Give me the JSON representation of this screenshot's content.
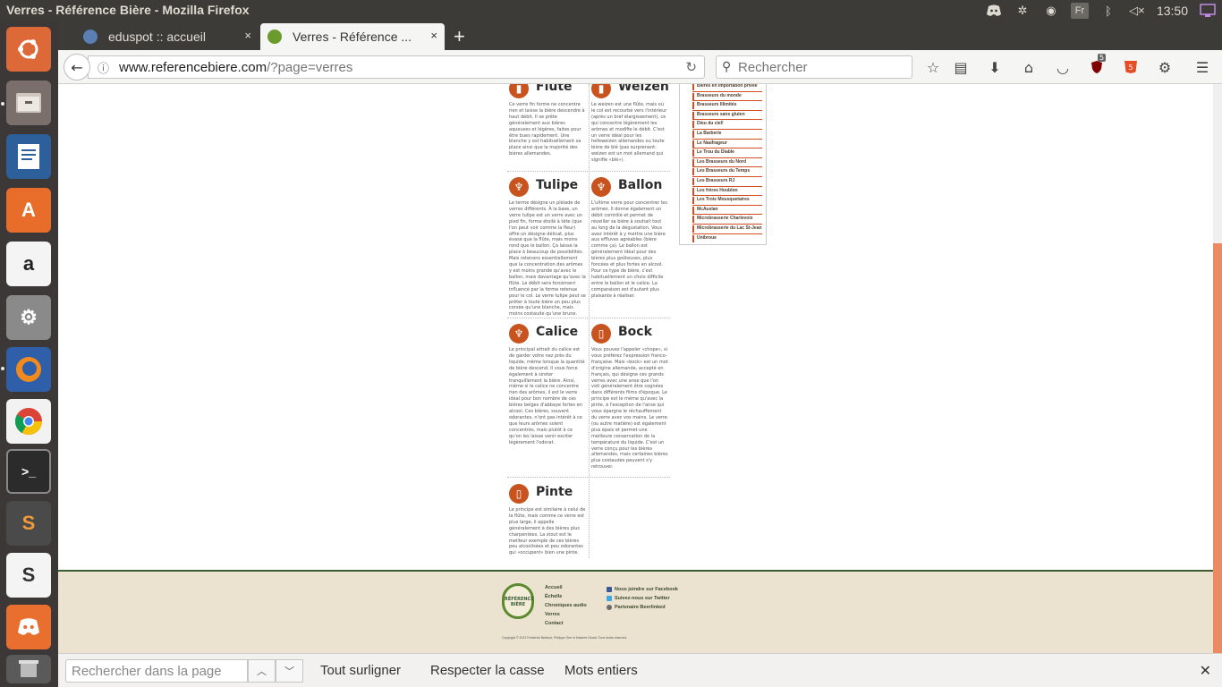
{
  "window": {
    "title": "Verres - Référence Bière - Mozilla Firefox",
    "keyboard_layout": "Fr",
    "clock": "13:50"
  },
  "tabs": [
    {
      "label": "eduspot :: accueil",
      "close": "×"
    },
    {
      "label": "Verres - Référence ...",
      "close": "×"
    }
  ],
  "newtab_label": "+",
  "urlbar": {
    "domain": "www.referencebiere.com",
    "path": "/?page=verres"
  },
  "searchbar": {
    "placeholder": "Rechercher"
  },
  "toolbar": {
    "ublock_badge": "5"
  },
  "glasses": [
    {
      "name": "Flûte",
      "icon": "flute-glass-icon",
      "text": "Ce verre fin forme ne concentre rien et laisse la bière descendre à haut débit. Il se prête généralement aux bières aqueuses et légères, faites pour être bues rapidement. Une blanche y est habituellement sa place ainsi que la majorité des bières allemandes."
    },
    {
      "name": "Weizen",
      "icon": "weizen-glass-icon",
      "text": "Le weizen est une flûte, mais où le col est recourbé vers l'intérieur (après un bref élargissement), ce qui concentre légèrement les arômes et modifie le débit. C'est un verre idéal pour les hefeweizen allemandes ou toute bière de blé (pas surprenant: weizen est un mot allemand qui signifie «blé»)."
    },
    {
      "name": "Tulipe",
      "icon": "tulip-glass-icon",
      "text": "Le terme désigne un pléiade de verres différents. À la base, un verre tulipe est un verre avec un pied fin, forme étoilé à tête (que l'on peut voir comme la fleur) offre un désigne délicat, plus évasé que la flûte, mais moins rond que le ballon. Ça laisse la place à beaucoup de possibilités. Mais retenons essentiellement que la concentration des arômes y est moins grande qu'avec le ballon, mais davantage qu'avec la flûte. Le débit sera forcément influencé par la forme retenue pour le col. Le verre tulipe peut se prêter à toute bière un peu plus corsée qu'une blanche, mais moins costaude qu'une brune."
    },
    {
      "name": "Ballon",
      "icon": "ballon-glass-icon",
      "text": "L'ultime verre pour concentrer les arômes. Il donne également un débit contrôlé et permet de réveiller sa bière à souhait tout au long de la dégustation. Vous avez intérêt à y mettre une bière aux effluves agréables (bière comme ça). Le ballon est généralement idéal pour des bières plus goûteuses, plus foncées et plus fortes en alcool. Pour ce type de bière, c'est habituellement un choix difficile entre le ballon et le calice. La comparaison est d'autant plus plaisante à réaliser."
    },
    {
      "name": "Calice",
      "icon": "calice-glass-icon",
      "text": "Le principal attrait du calice est de garder votre nez près du liquide, même lorsque la quantité de bière descend. Il vous force également à siroter tranquillement la bière. Ainsi, même si le calice ne concentre rien des arômes, il est le verre idéal pour bon nombre de ces bières belges d'abbaye fortes en alcool. Ces bières, souvent odorantes, n'ont pas intérêt à ce que leurs arômes soient concentrés, mais plutôt à ce qu'on les laisse venir exciter légèrement l'odorat."
    },
    {
      "name": "Bock",
      "icon": "bock-mug-icon",
      "text": "Vous pouvez l'appeler «chope», si vous préférez l'expression franco-française. Mais «bock» est un mot d'origine allemande, accepté en français, qui désigne ces grands verres avec une anse que l'on voit généralement être cognées dans différents films d'époque. Le principe est le même qu'avec la pinte, à l'exception de l'anse qui vous épargne le réchauffement du verre avec vos mains. Le verre (ou autre matière) est également plus épais et permet une meilleure conservation de la température du liquide. C'est un verre conçu pour les bières allemandes, mais certaines bières plus costaudes peuvent s'y retrouver."
    },
    {
      "name": "Pinte",
      "icon": "pint-glass-icon",
      "text": "Le principe est similaire à celui de la flûte, mais comme ce verre est plus large, il appelle généralement à des bières plus charpentées. La stout est le meilleur exemple de ces bières peu alcoolisées et peu odorantes qui «occupent» bien une pinte."
    }
  ],
  "brewers": [
    "Bières en importation privée",
    "Brasseurs du monde",
    "Brasseurs Illimités",
    "Brasseurs sans gluten",
    "Dieu du ciel!",
    "La Barberie",
    "Le Naufrageur",
    "Le Trou du Diable",
    "Les Brasseurs du Nord",
    "Les Brasseurs du Temps",
    "Les Brasseurs RJ",
    "Les frères Houblon",
    "Les Trois Mousquetaires",
    "McAuslan",
    "Microbrasserie Charlevoix",
    "Microbrasserie du Lac St-Jean",
    "Unibroue"
  ],
  "footer": {
    "logo_text": "RÉFÉRENCE BIÈRE",
    "nav": [
      "Accueil",
      "Échelle",
      "Chroniques audio",
      "Verres",
      "Contact"
    ],
    "social": [
      {
        "label": "Nous joindre sur Facebook",
        "color": "#3b5998",
        "icon": "facebook-icon"
      },
      {
        "label": "Suivez-nous sur Twitter",
        "color": "#3ea9e0",
        "icon": "twitter-icon"
      },
      {
        "label": "Partenaire Beerlinked",
        "color": "#6b6b6b",
        "icon": "beerlinked-icon"
      }
    ],
    "copyright": "Copyright © 2012 Frédérick Bellavoi, Philippe Gee et Maxime Girard. Tous droits réservés."
  },
  "findbar": {
    "placeholder": "Rechercher dans la page",
    "highlight_all": "Tout surligner",
    "match_case": "Respecter la casse",
    "whole_words": "Mots entiers"
  },
  "colors": {
    "accent": "#c8531e",
    "footer_bg": "#ebe2cf",
    "footer_border": "#3b5e35",
    "scrollbar": "#ec8a64"
  }
}
